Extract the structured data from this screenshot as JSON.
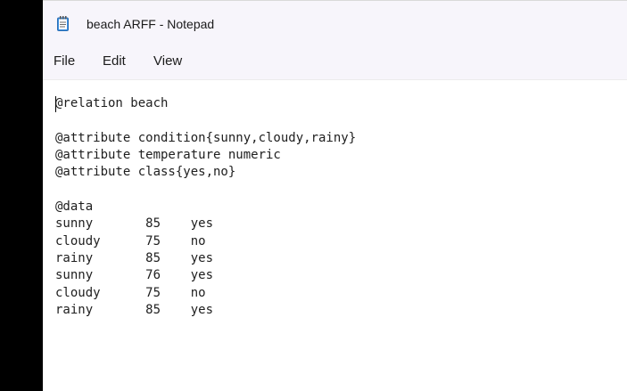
{
  "window": {
    "title": "beach ARFF - Notepad"
  },
  "app_icon": "notepad-icon",
  "menu": {
    "file": "File",
    "edit": "Edit",
    "view": "View"
  },
  "editor": {
    "text": "@relation beach\n\n@attribute condition{sunny,cloudy,rainy}\n@attribute temperature numeric\n@attribute class{yes,no}\n\n@data\nsunny       85    yes\ncloudy      75    no\nrainy       85    yes\nsunny       76    yes\ncloudy      75    no\nrainy       85    yes"
  },
  "colors": {
    "titlebar_bg": "#f7f5fb",
    "editor_bg": "#ffffff",
    "desktop_bg": "#000000"
  }
}
